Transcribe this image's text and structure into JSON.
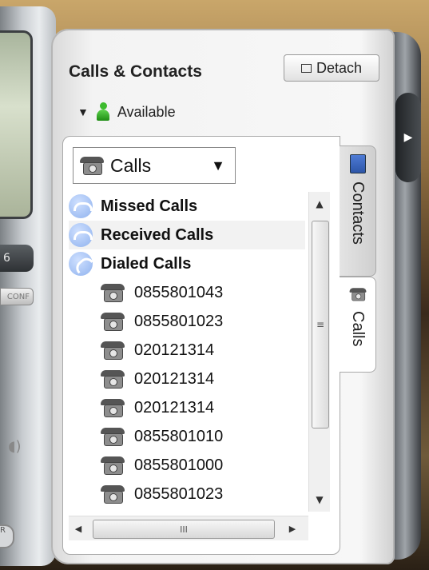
{
  "panel": {
    "title": "Calls & Contacts",
    "detach_label": "Detach",
    "presence_status": "Available"
  },
  "filter": {
    "selected": "Calls"
  },
  "groups": [
    {
      "label": "Missed Calls"
    },
    {
      "label": "Received Calls"
    },
    {
      "label": "Dialed Calls"
    }
  ],
  "dialed_numbers": [
    "0855801043",
    "0855801023",
    "020121314",
    "020121314",
    "020121314",
    "0855801010",
    "0855801000",
    "0855801023"
  ],
  "tabs": {
    "contacts": "Contacts",
    "calls": "Calls"
  },
  "phone": {
    "button_label": "6",
    "conf_label": "CONF",
    "r_label": "R"
  }
}
